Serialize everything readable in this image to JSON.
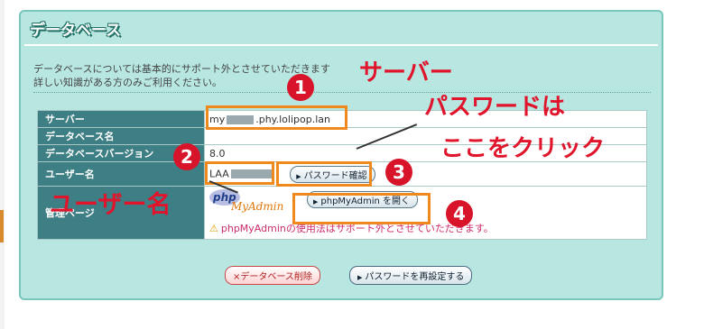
{
  "panel": {
    "title": "データベース",
    "notice_line1": "データベースについては基本的にサポート外とさせていただきます",
    "notice_line2": "詳しい知識がある方のみご利用ください。"
  },
  "table": {
    "server_label": "サーバー",
    "server_prefix": "my",
    "server_suffix": ".phy.lolipop.lan",
    "dbname_label": "データベース名",
    "dbname_value": "",
    "version_label": "データベースバージョン",
    "version_value": "8.0",
    "user_label": "ユーザー名",
    "user_prefix": "LAA",
    "password_button": "パスワード確認",
    "manage_label": "管理ページ",
    "pma_logo_php": "php",
    "pma_logo_my": "MyAdmin",
    "pma_button": "phpMyAdmin を開く",
    "pma_warning": "phpMyAdminの使用法はサポート外とさせていただきます。"
  },
  "buttons": {
    "delete": "×データベース削除",
    "reset_password": "パスワードを再設定する"
  },
  "annotations": {
    "server": "サーバー",
    "password_line1": "パスワードは",
    "password_line2": "ここをクリック",
    "username": "ユーザー名",
    "n1": "1",
    "n2": "2",
    "n3": "3",
    "n4": "4"
  },
  "colors": {
    "panel_bg": "#b8e7e2",
    "header_cell": "#3d7f84",
    "highlight": "#f0891c",
    "annotation": "#e0152c"
  }
}
